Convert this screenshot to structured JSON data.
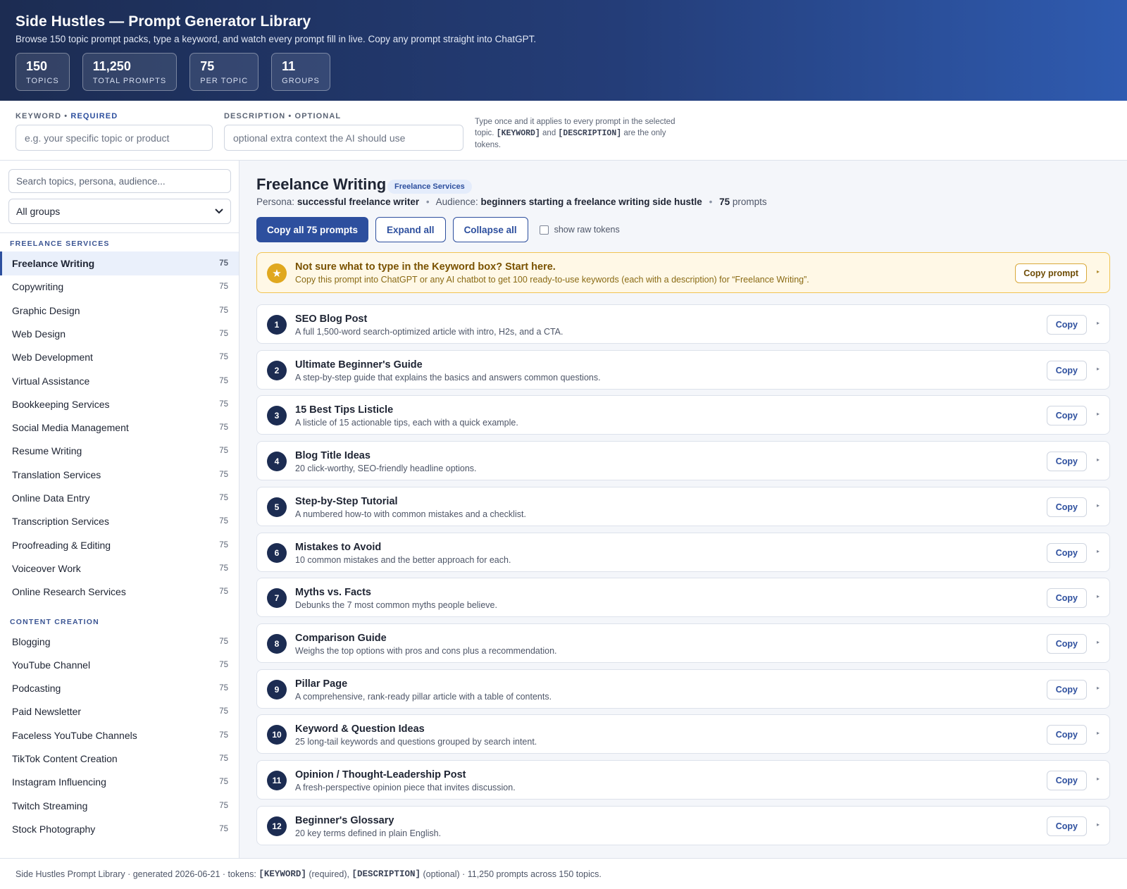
{
  "header": {
    "title": "Side Hustles — Prompt Generator Library",
    "subtitle": "Browse 150 topic prompt packs, type a keyword, and watch every prompt fill in live. Copy any prompt straight into ChatGPT.",
    "stats": [
      {
        "value": "150",
        "label": "Topics"
      },
      {
        "value": "11,250",
        "label": "Total Prompts"
      },
      {
        "value": "75",
        "label": "Per Topic"
      },
      {
        "value": "11",
        "label": "Groups"
      }
    ]
  },
  "inputs": {
    "keyword": {
      "label": "Keyword",
      "tag": "Required",
      "placeholder": "e.g. your specific topic or product",
      "value": ""
    },
    "description": {
      "label": "Description",
      "tag": "Optional",
      "placeholder": "optional extra context the AI should use",
      "value": ""
    },
    "hint": {
      "pre": "Type once and it applies to every prompt in the selected topic.",
      "token1": "[KEYWORD]",
      "mid": "and",
      "token2": "[DESCRIPTION]",
      "post": "are the only tokens."
    }
  },
  "sidebar": {
    "search_placeholder": "Search topics, persona, audience...",
    "group_select": "All groups",
    "groups": [
      {
        "name": "Freelance Services",
        "items": [
          {
            "label": "Freelance Writing",
            "count": "75",
            "active": true
          },
          {
            "label": "Copywriting",
            "count": "75"
          },
          {
            "label": "Graphic Design",
            "count": "75"
          },
          {
            "label": "Web Design",
            "count": "75"
          },
          {
            "label": "Web Development",
            "count": "75"
          },
          {
            "label": "Virtual Assistance",
            "count": "75"
          },
          {
            "label": "Bookkeeping Services",
            "count": "75"
          },
          {
            "label": "Social Media Management",
            "count": "75"
          },
          {
            "label": "Resume Writing",
            "count": "75"
          },
          {
            "label": "Translation Services",
            "count": "75"
          },
          {
            "label": "Online Data Entry",
            "count": "75"
          },
          {
            "label": "Transcription Services",
            "count": "75"
          },
          {
            "label": "Proofreading & Editing",
            "count": "75"
          },
          {
            "label": "Voiceover Work",
            "count": "75"
          },
          {
            "label": "Online Research Services",
            "count": "75"
          }
        ]
      },
      {
        "name": "Content Creation",
        "items": [
          {
            "label": "Blogging",
            "count": "75"
          },
          {
            "label": "YouTube Channel",
            "count": "75"
          },
          {
            "label": "Podcasting",
            "count": "75"
          },
          {
            "label": "Paid Newsletter",
            "count": "75"
          },
          {
            "label": "Faceless YouTube Channels",
            "count": "75"
          },
          {
            "label": "TikTok Content Creation",
            "count": "75"
          },
          {
            "label": "Instagram Influencing",
            "count": "75"
          },
          {
            "label": "Twitch Streaming",
            "count": "75"
          },
          {
            "label": "Stock Photography",
            "count": "75"
          }
        ]
      }
    ]
  },
  "main": {
    "title": "Freelance Writing",
    "badge": "Freelance Services",
    "persona_label": "Persona:",
    "persona": "successful freelance writer",
    "audience_label": "Audience:",
    "audience": "beginners starting a freelance writing side hustle",
    "prompt_count": "75",
    "prompt_count_label": "prompts",
    "copy_all_label": "Copy all 75 prompts",
    "expand_label": "Expand all",
    "collapse_label": "Collapse all",
    "raw_tokens_label": "show raw tokens",
    "starter": {
      "title": "Not sure what to type in the Keyword box? Start here.",
      "desc": "Copy this prompt into ChatGPT or any AI chatbot to get 100 ready-to-use keywords (each with a description) for “Freelance Writing”.",
      "copy_label": "Copy prompt"
    },
    "copy_label": "Copy",
    "prompts": [
      {
        "num": "1",
        "title": "SEO Blog Post",
        "desc": "A full 1,500-word search-optimized article with intro, H2s, and a CTA."
      },
      {
        "num": "2",
        "title": "Ultimate Beginner's Guide",
        "desc": "A step-by-step guide that explains the basics and answers common questions."
      },
      {
        "num": "3",
        "title": "15 Best Tips Listicle",
        "desc": "A listicle of 15 actionable tips, each with a quick example."
      },
      {
        "num": "4",
        "title": "Blog Title Ideas",
        "desc": "20 click-worthy, SEO-friendly headline options."
      },
      {
        "num": "5",
        "title": "Step-by-Step Tutorial",
        "desc": "A numbered how-to with common mistakes and a checklist."
      },
      {
        "num": "6",
        "title": "Mistakes to Avoid",
        "desc": "10 common mistakes and the better approach for each."
      },
      {
        "num": "7",
        "title": "Myths vs. Facts",
        "desc": "Debunks the 7 most common myths people believe."
      },
      {
        "num": "8",
        "title": "Comparison Guide",
        "desc": "Weighs the top options with pros and cons plus a recommendation."
      },
      {
        "num": "9",
        "title": "Pillar Page",
        "desc": "A comprehensive, rank-ready pillar article with a table of contents."
      },
      {
        "num": "10",
        "title": "Keyword & Question Ideas",
        "desc": "25 long-tail keywords and questions grouped by search intent."
      },
      {
        "num": "11",
        "title": "Opinion / Thought-Leadership Post",
        "desc": "A fresh-perspective opinion piece that invites discussion."
      },
      {
        "num": "12",
        "title": "Beginner's Glossary",
        "desc": "20 key terms defined in plain English."
      }
    ]
  },
  "footer": {
    "pre": "Side Hustles Prompt Library · generated 2026-06-21 · tokens:",
    "token1": "[KEYWORD]",
    "req": "(required),",
    "token2": "[DESCRIPTION]",
    "post": "(optional) · 11,250 prompts across 150 topics."
  }
}
